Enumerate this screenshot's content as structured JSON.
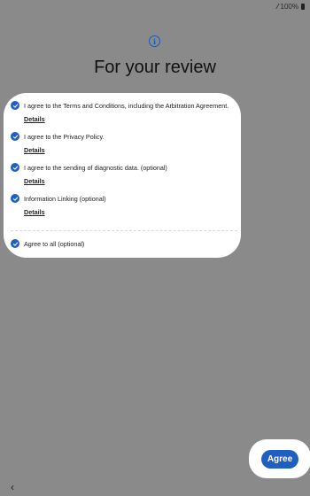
{
  "status": {
    "signal": "⁄⁄",
    "battery_percent": "100%"
  },
  "header": {
    "icon": "info-icon",
    "title": "For your review"
  },
  "agreements": [
    {
      "label": "I agree to the Terms and Conditions, including the Arbitration Agreement.",
      "checked": true,
      "details_label": "Details"
    },
    {
      "label": "I agree to the Privacy Policy.",
      "checked": true,
      "details_label": "Details"
    },
    {
      "label": "I agree to the sending of diagnostic data. (optional)",
      "checked": true,
      "details_label": "Details"
    },
    {
      "label": "Information Linking (optional)",
      "checked": true,
      "details_label": "Details"
    }
  ],
  "agree_all": {
    "label": "Agree to all (optional)",
    "checked": true
  },
  "footer": {
    "agree_button": "Agree",
    "back_icon": "back-chevron-icon",
    "back_glyph": "‹"
  },
  "colors": {
    "accent": "#1f5fc0",
    "scrim": "#8a8a8a",
    "card": "#ffffff"
  }
}
